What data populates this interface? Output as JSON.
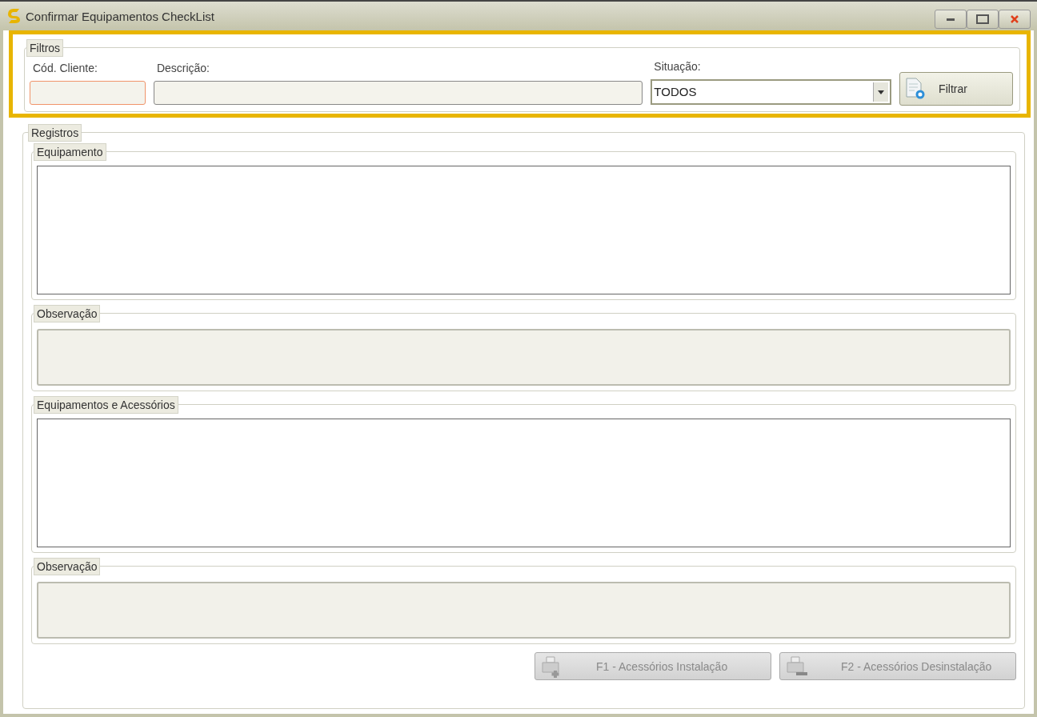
{
  "window": {
    "title": "Confirmar Equipamentos CheckList"
  },
  "filters": {
    "legend": "Filtros",
    "highlighted": true,
    "fields": [
      {
        "kind": "text",
        "label": "Cód. Cliente:",
        "focused": true
      },
      {
        "kind": "text",
        "label": "Descrição:",
        "focused": false
      },
      {
        "kind": "select",
        "label": "Situação:",
        "value": "TODOS"
      }
    ],
    "button": "Filtrar"
  },
  "records": {
    "legend": "Registros",
    "sections": [
      {
        "legend": "Equipamento",
        "kind": "list"
      },
      {
        "legend": "Observação",
        "kind": "memo"
      },
      {
        "legend": "Equipamentos e Acessórios",
        "kind": "list"
      },
      {
        "legend": "Observação",
        "kind": "memo"
      }
    ],
    "buttons": [
      {
        "label": "F1 - Acessórios Instalação",
        "kind": "add",
        "disabled": true
      },
      {
        "label": "F2 - Acessórios Desinstalação",
        "kind": "remove",
        "disabled": true
      }
    ]
  }
}
